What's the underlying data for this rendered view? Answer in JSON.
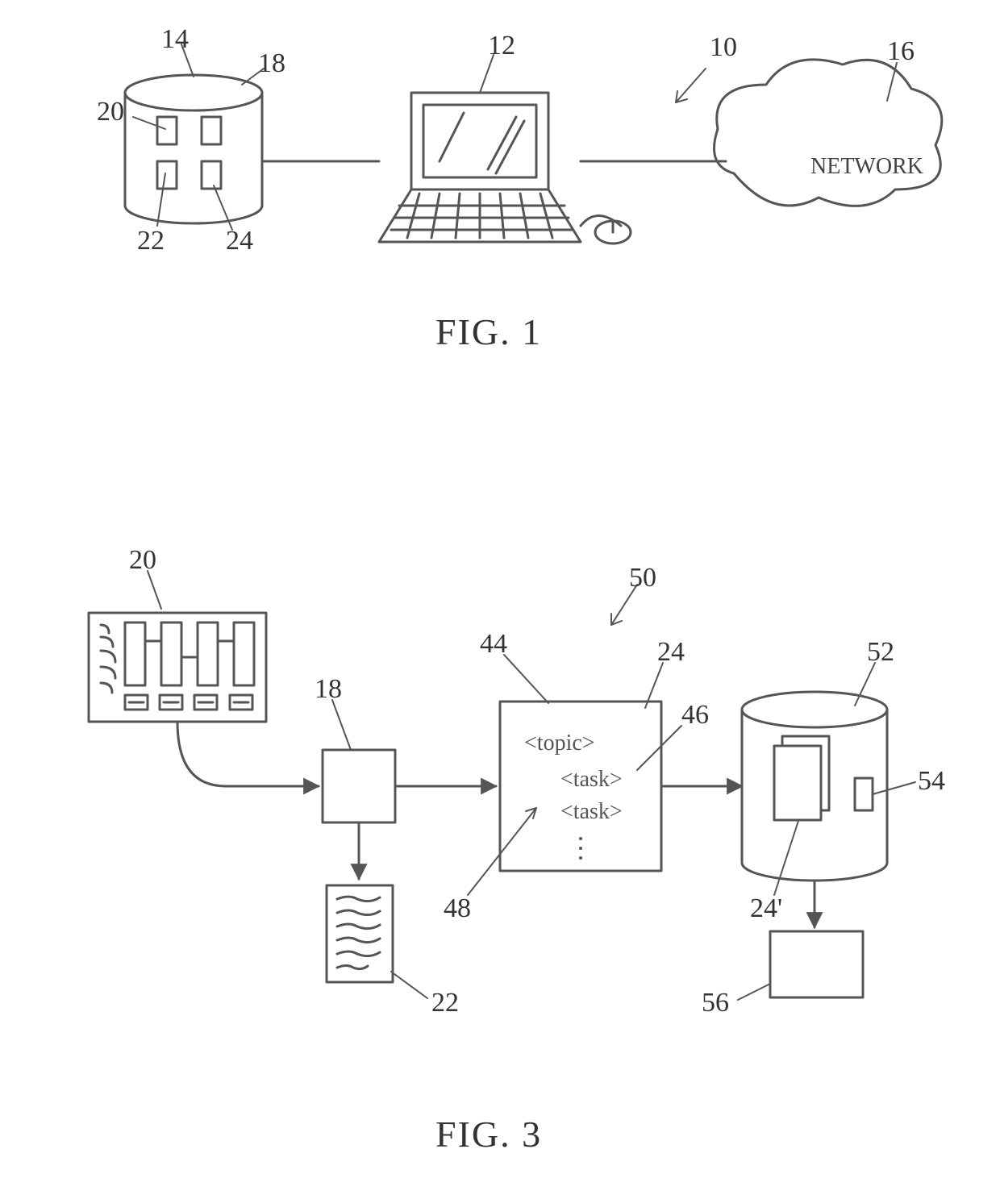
{
  "fig1": {
    "caption": "FIG. 1",
    "network_label": "NETWORK",
    "refs": {
      "r10": "10",
      "r12": "12",
      "r14": "14",
      "r16": "16",
      "r18": "18",
      "r20": "20",
      "r22": "22",
      "r24": "24"
    }
  },
  "fig3": {
    "caption": "FIG. 3",
    "topic_tag": "<topic>",
    "task_tag1": "<task>",
    "task_tag2": "<task>",
    "refs": {
      "r20": "20",
      "r18": "18",
      "r22": "22",
      "r24": "24",
      "r24p": "24'",
      "r44": "44",
      "r46": "46",
      "r48": "48",
      "r50": "50",
      "r52": "52",
      "r54": "54",
      "r56": "56"
    }
  }
}
